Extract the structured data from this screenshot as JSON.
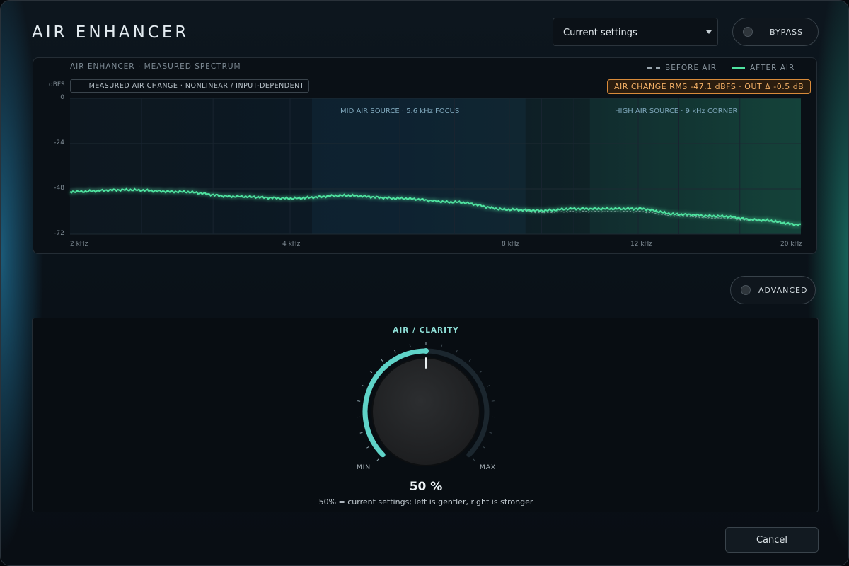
{
  "header": {
    "title": "AIR ENHANCER",
    "preset_value": "Current settings",
    "bypass_label": "BYPASS"
  },
  "spectrum": {
    "title": "AIR ENHANCER · MEASURED SPECTRUM",
    "legend_before": "BEFORE AIR",
    "legend_after": "AFTER AIR",
    "unit_label": "dBFS",
    "measured_tag": "MEASURED AIR CHANGE · NONLINEAR / INPUT-DEPENDENT",
    "rms_tag": "AIR CHANGE RMS -47.1 dBFS · OUT Δ -0.5 dB",
    "zone_mid": "MID AIR SOURCE · 5.6 kHz FOCUS",
    "zone_high": "HIGH AIR SOURCE · 9 kHz CORNER"
  },
  "chart_data": {
    "type": "line",
    "xlabel": "",
    "ylabel": "dBFS",
    "x_ticks": [
      "2 kHz",
      "4 kHz",
      "8 kHz",
      "12 kHz",
      "20 kHz"
    ],
    "y_ticks": [
      "0",
      "-24",
      "-48",
      "-72"
    ],
    "ylim": [
      -72,
      0
    ],
    "grid": true,
    "legend": "top-right",
    "colors": {
      "before": "#9aa6ae",
      "after": "#4fe3a0"
    },
    "series": [
      {
        "name": "BEFORE AIR",
        "x_khz": [
          2,
          2.5,
          3,
          3.5,
          4,
          5,
          6,
          7,
          8,
          9,
          10,
          12,
          14,
          16,
          18,
          20
        ],
        "values": [
          -49.5,
          -48.5,
          -49.5,
          -52,
          -53,
          -51.5,
          -53,
          -55,
          -59,
          -60.5,
          -60,
          -60,
          -62.5,
          -63.5,
          -65,
          -67
        ]
      },
      {
        "name": "AFTER AIR",
        "x_khz": [
          2,
          2.5,
          3,
          3.5,
          4,
          5,
          6,
          7,
          8,
          9,
          10,
          12,
          14,
          16,
          18,
          20
        ],
        "values": [
          -49.5,
          -48.5,
          -49.5,
          -52,
          -53,
          -51.5,
          -53,
          -55,
          -59,
          -59.5,
          -58.5,
          -58.5,
          -61.5,
          -62.5,
          -64.5,
          -67
        ]
      }
    ]
  },
  "advanced": {
    "label": "ADVANCED"
  },
  "knob": {
    "title": "AIR / CLARITY",
    "min_label": "MIN",
    "max_label": "MAX",
    "value_percent": 50,
    "value_text": "50 %",
    "hint": "50% = current settings; left is gentler, right is stronger",
    "accent": "#5fd3c8"
  },
  "footer": {
    "cancel_label": "Cancel"
  }
}
